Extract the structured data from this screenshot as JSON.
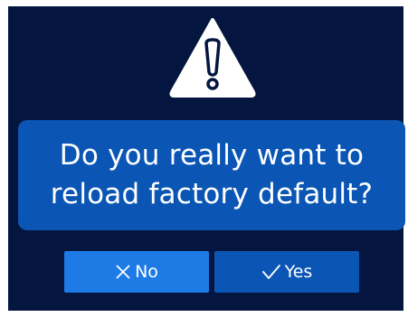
{
  "dialog": {
    "message": "Do you really want to\nreload factory default?",
    "icon": "warning-triangle-icon"
  },
  "buttons": {
    "no": {
      "label": "No",
      "icon": "close-x-icon"
    },
    "yes": {
      "label": "Yes",
      "icon": "checkmark-icon"
    }
  },
  "colors": {
    "background": "#04163f",
    "message_box": "#0b56b5",
    "no_button": "#1e7be6",
    "yes_button": "#0b56b5",
    "text": "#ffffff"
  }
}
